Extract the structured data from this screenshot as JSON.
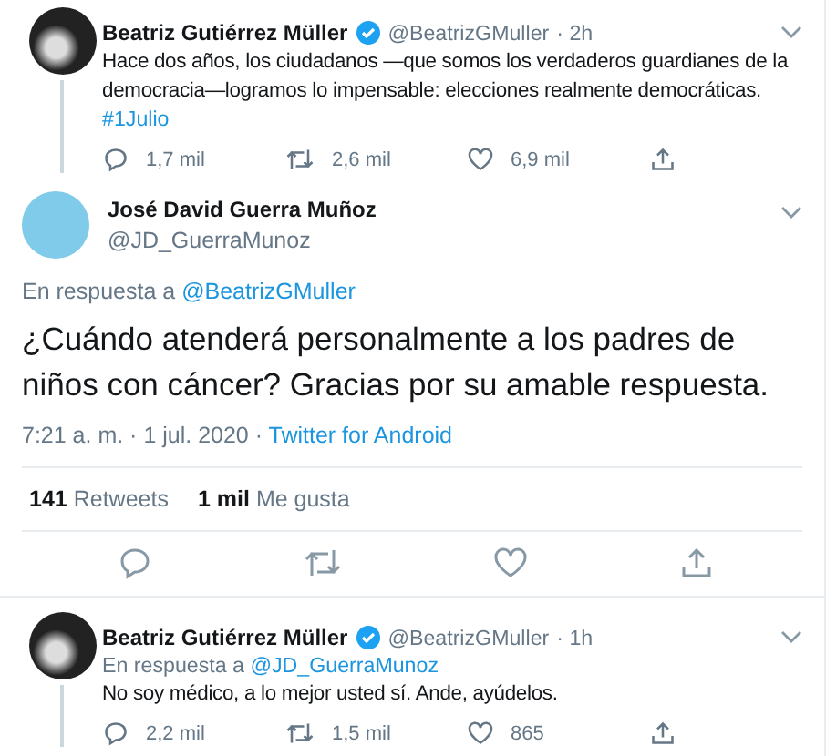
{
  "top_tweet": {
    "name": "Beatriz Gutiérrez Müller",
    "verified": true,
    "handle": "@BeatrizGMuller",
    "time": "· 2h",
    "text": "Hace dos años, los ciudadanos —que somos los verdaderos guardianes de la democracia—logramos lo impensable: elecciones realmente democráticas.",
    "hashtag": "#1Julio",
    "replies": "1,7 mil",
    "retweets": "2,6 mil",
    "likes": "6,9 mil"
  },
  "main_tweet": {
    "name": "José David Guerra Muñoz",
    "handle": "@JD_GuerraMunoz",
    "reply_label": "En respuesta a",
    "reply_to": "@BeatrizGMuller",
    "text": "¿Cuándo atenderá personalmente a los padres de niños con cáncer? Gracias por su amable respuesta.",
    "datetime": "7:21 a. m. · 1 jul. 2020 ·",
    "source": "Twitter for Android",
    "stats": [
      {
        "count": "141",
        "label": "Retweets"
      },
      {
        "count": "1 mil",
        "label": "Me gusta"
      }
    ]
  },
  "reply_tweet": {
    "name": "Beatriz Gutiérrez Müller",
    "verified": true,
    "handle": "@BeatrizGMuller",
    "time": "· 1h",
    "reply_label": "En respuesta a",
    "reply_to": "@JD_GuerraMunoz",
    "text": "No soy médico, a lo mejor usted sí. Ande, ayúdelos.",
    "replies": "2,2 mil",
    "retweets": "1,5 mil",
    "likes": "865"
  }
}
